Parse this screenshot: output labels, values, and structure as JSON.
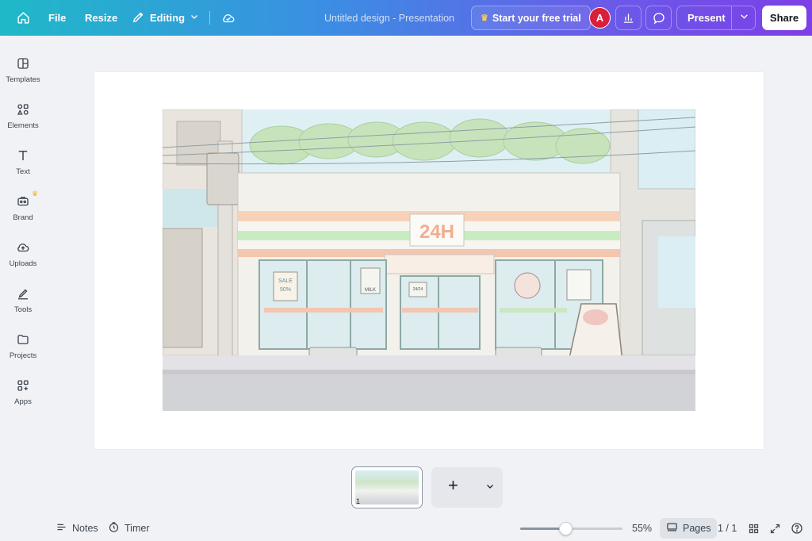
{
  "topbar": {
    "file": "File",
    "resize": "Resize",
    "editing": "Editing",
    "doc_title": "Untitled design - Presentation",
    "trial": "Start your free trial",
    "avatar": "A",
    "present": "Present",
    "share": "Share"
  },
  "sidebar": {
    "items": [
      {
        "label": "Templates",
        "icon": "templates-icon"
      },
      {
        "label": "Elements",
        "icon": "elements-icon"
      },
      {
        "label": "Text",
        "icon": "text-icon"
      },
      {
        "label": "Brand",
        "icon": "brand-icon"
      },
      {
        "label": "Uploads",
        "icon": "uploads-icon"
      },
      {
        "label": "Tools",
        "icon": "tools-icon"
      },
      {
        "label": "Projects",
        "icon": "projects-icon"
      },
      {
        "label": "Apps",
        "icon": "apps-icon"
      }
    ]
  },
  "canvas": {
    "sign": "24H",
    "door_sign": "24/24",
    "window_sale": "SALE",
    "window_pct": "50%",
    "window_milk": "MILK"
  },
  "pages_strip": {
    "thumb_number": "1"
  },
  "bottombar": {
    "notes": "Notes",
    "timer": "Timer",
    "zoom": "55%",
    "zoom_fraction": 0.44,
    "pages": "Pages",
    "page_count": "1 / 1"
  },
  "colors": {
    "gradient_start": "#1fb9c8",
    "gradient_end": "#7d3fe6",
    "avatar": "#d91f3b",
    "crown": "#f7c948"
  }
}
